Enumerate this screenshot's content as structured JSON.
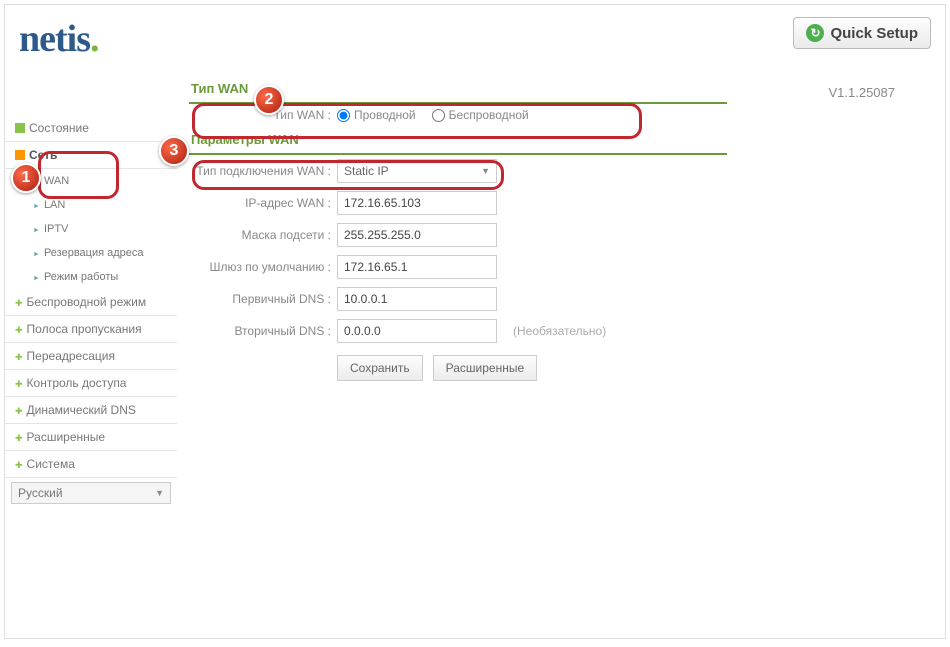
{
  "header": {
    "logo": "netis",
    "quick_setup": "Quick Setup",
    "version": "V1.1.25087"
  },
  "sidebar": {
    "items": [
      {
        "label": "Состояние"
      },
      {
        "label": "Сеть"
      },
      {
        "label": "WAN"
      },
      {
        "label": "LAN"
      },
      {
        "label": "IPTV"
      },
      {
        "label": "Резервация адреса"
      },
      {
        "label": "Режим работы"
      },
      {
        "label": "Беспроводной режим"
      },
      {
        "label": "Полоса пропускания"
      },
      {
        "label": "Переадресация"
      },
      {
        "label": "Контроль доступа"
      },
      {
        "label": "Динамический DNS"
      },
      {
        "label": "Расширенные"
      },
      {
        "label": "Система"
      }
    ],
    "language": "Русский"
  },
  "content": {
    "section1_title": "Тип WAN",
    "wan_type_label": "Тип WAN :",
    "wan_type_opts": [
      "Проводной",
      "Беспроводной"
    ],
    "section2_title": "Параметры WAN",
    "conn_type_label": "Тип подключения WAN :",
    "conn_type_value": "Static IP",
    "rows": [
      {
        "label": "IP-адрес WAN :",
        "value": "172.16.65.103"
      },
      {
        "label": "Маска подсети :",
        "value": "255.255.255.0"
      },
      {
        "label": "Шлюз по умолчанию :",
        "value": "172.16.65.1"
      },
      {
        "label": "Первичный DNS :",
        "value": "10.0.0.1"
      },
      {
        "label": "Вторичный DNS :",
        "value": "0.0.0.0"
      }
    ],
    "optional": "(Необязательно)",
    "buttons": {
      "save": "Сохранить",
      "advanced": "Расширенные"
    }
  },
  "markers": {
    "m1": "1",
    "m2": "2",
    "m3": "3"
  }
}
